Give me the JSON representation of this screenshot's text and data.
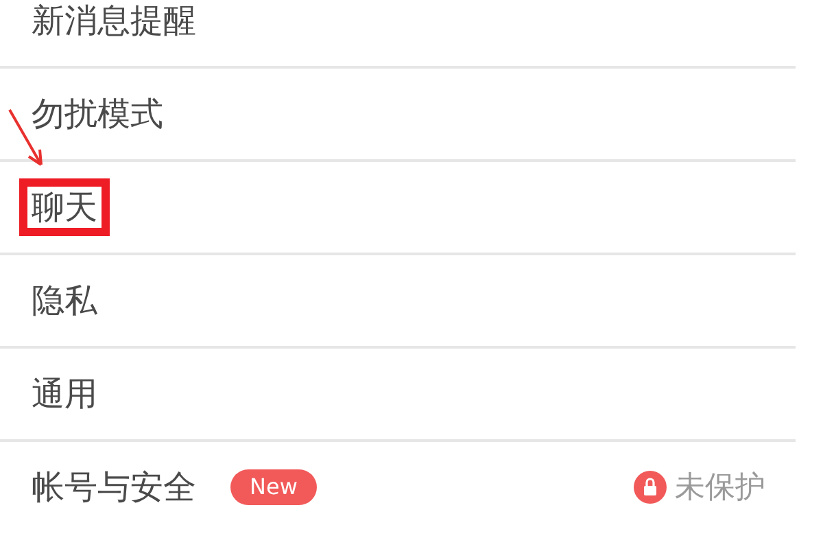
{
  "settings": [
    {
      "label": "新消息提醒",
      "highlighted": false
    },
    {
      "label": "勿扰模式",
      "highlighted": false
    },
    {
      "label": "聊天",
      "highlighted": true
    },
    {
      "label": "隐私",
      "highlighted": false
    },
    {
      "label": "通用",
      "highlighted": false
    },
    {
      "label": "帐号与安全",
      "highlighted": false,
      "badge": "New",
      "status": "未保护"
    }
  ]
}
